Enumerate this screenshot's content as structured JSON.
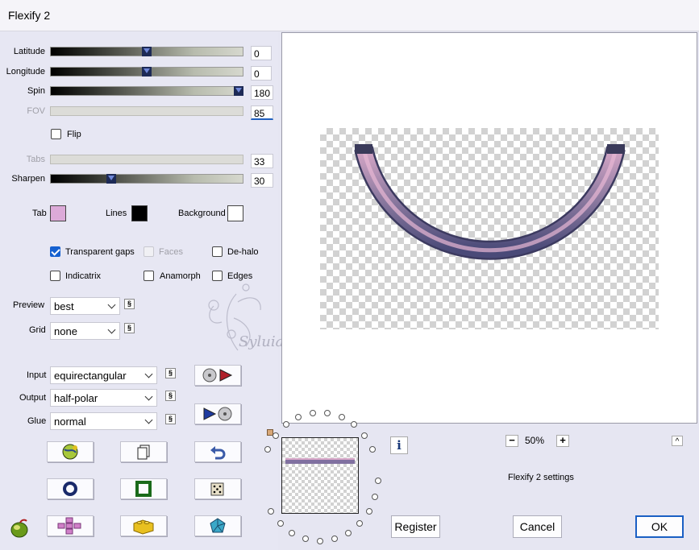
{
  "window": {
    "title": "Flexify 2"
  },
  "sliders": {
    "latitude": {
      "label": "Latitude",
      "value": "0"
    },
    "longitude": {
      "label": "Longitude",
      "value": "0"
    },
    "spin": {
      "label": "Spin",
      "value": "180"
    },
    "fov": {
      "label": "FOV",
      "value": "85"
    },
    "tabs": {
      "label": "Tabs",
      "value": "33"
    },
    "sharpen": {
      "label": "Sharpen",
      "value": "30"
    }
  },
  "flip": {
    "label": "Flip",
    "checked": false
  },
  "colors": {
    "tab": {
      "label": "Tab",
      "color": "#dcaad8"
    },
    "lines": {
      "label": "Lines",
      "color": "#000000"
    },
    "background": {
      "label": "Background",
      "color": "#ffffff"
    }
  },
  "options": {
    "transparent_gaps": {
      "label": "Transparent gaps",
      "checked": true
    },
    "faces": {
      "label": "Faces",
      "checked": false
    },
    "dehalo": {
      "label": "De-halo",
      "checked": false
    },
    "indicatrix": {
      "label": "Indicatrix",
      "checked": false
    },
    "anamorph": {
      "label": "Anamorph",
      "checked": false
    },
    "edges": {
      "label": "Edges",
      "checked": false
    }
  },
  "selects": {
    "preview": {
      "label": "Preview",
      "value": "best"
    },
    "grid": {
      "label": "Grid",
      "value": "none"
    },
    "input": {
      "label": "Input",
      "value": "equirectangular"
    },
    "output": {
      "label": "Output",
      "value": "half-polar"
    },
    "glue": {
      "label": "Glue",
      "value": "normal"
    }
  },
  "link_glyph": "§",
  "zoom": {
    "value": "50%",
    "minus": "−",
    "plus": "+"
  },
  "settings_label": "Flexify 2 settings",
  "watermark": "Syluiane",
  "buttons": {
    "register": "Register",
    "cancel": "Cancel",
    "ok": "OK"
  },
  "info_glyph": "i",
  "collapse_glyph": "^",
  "accent": "#1560d0"
}
